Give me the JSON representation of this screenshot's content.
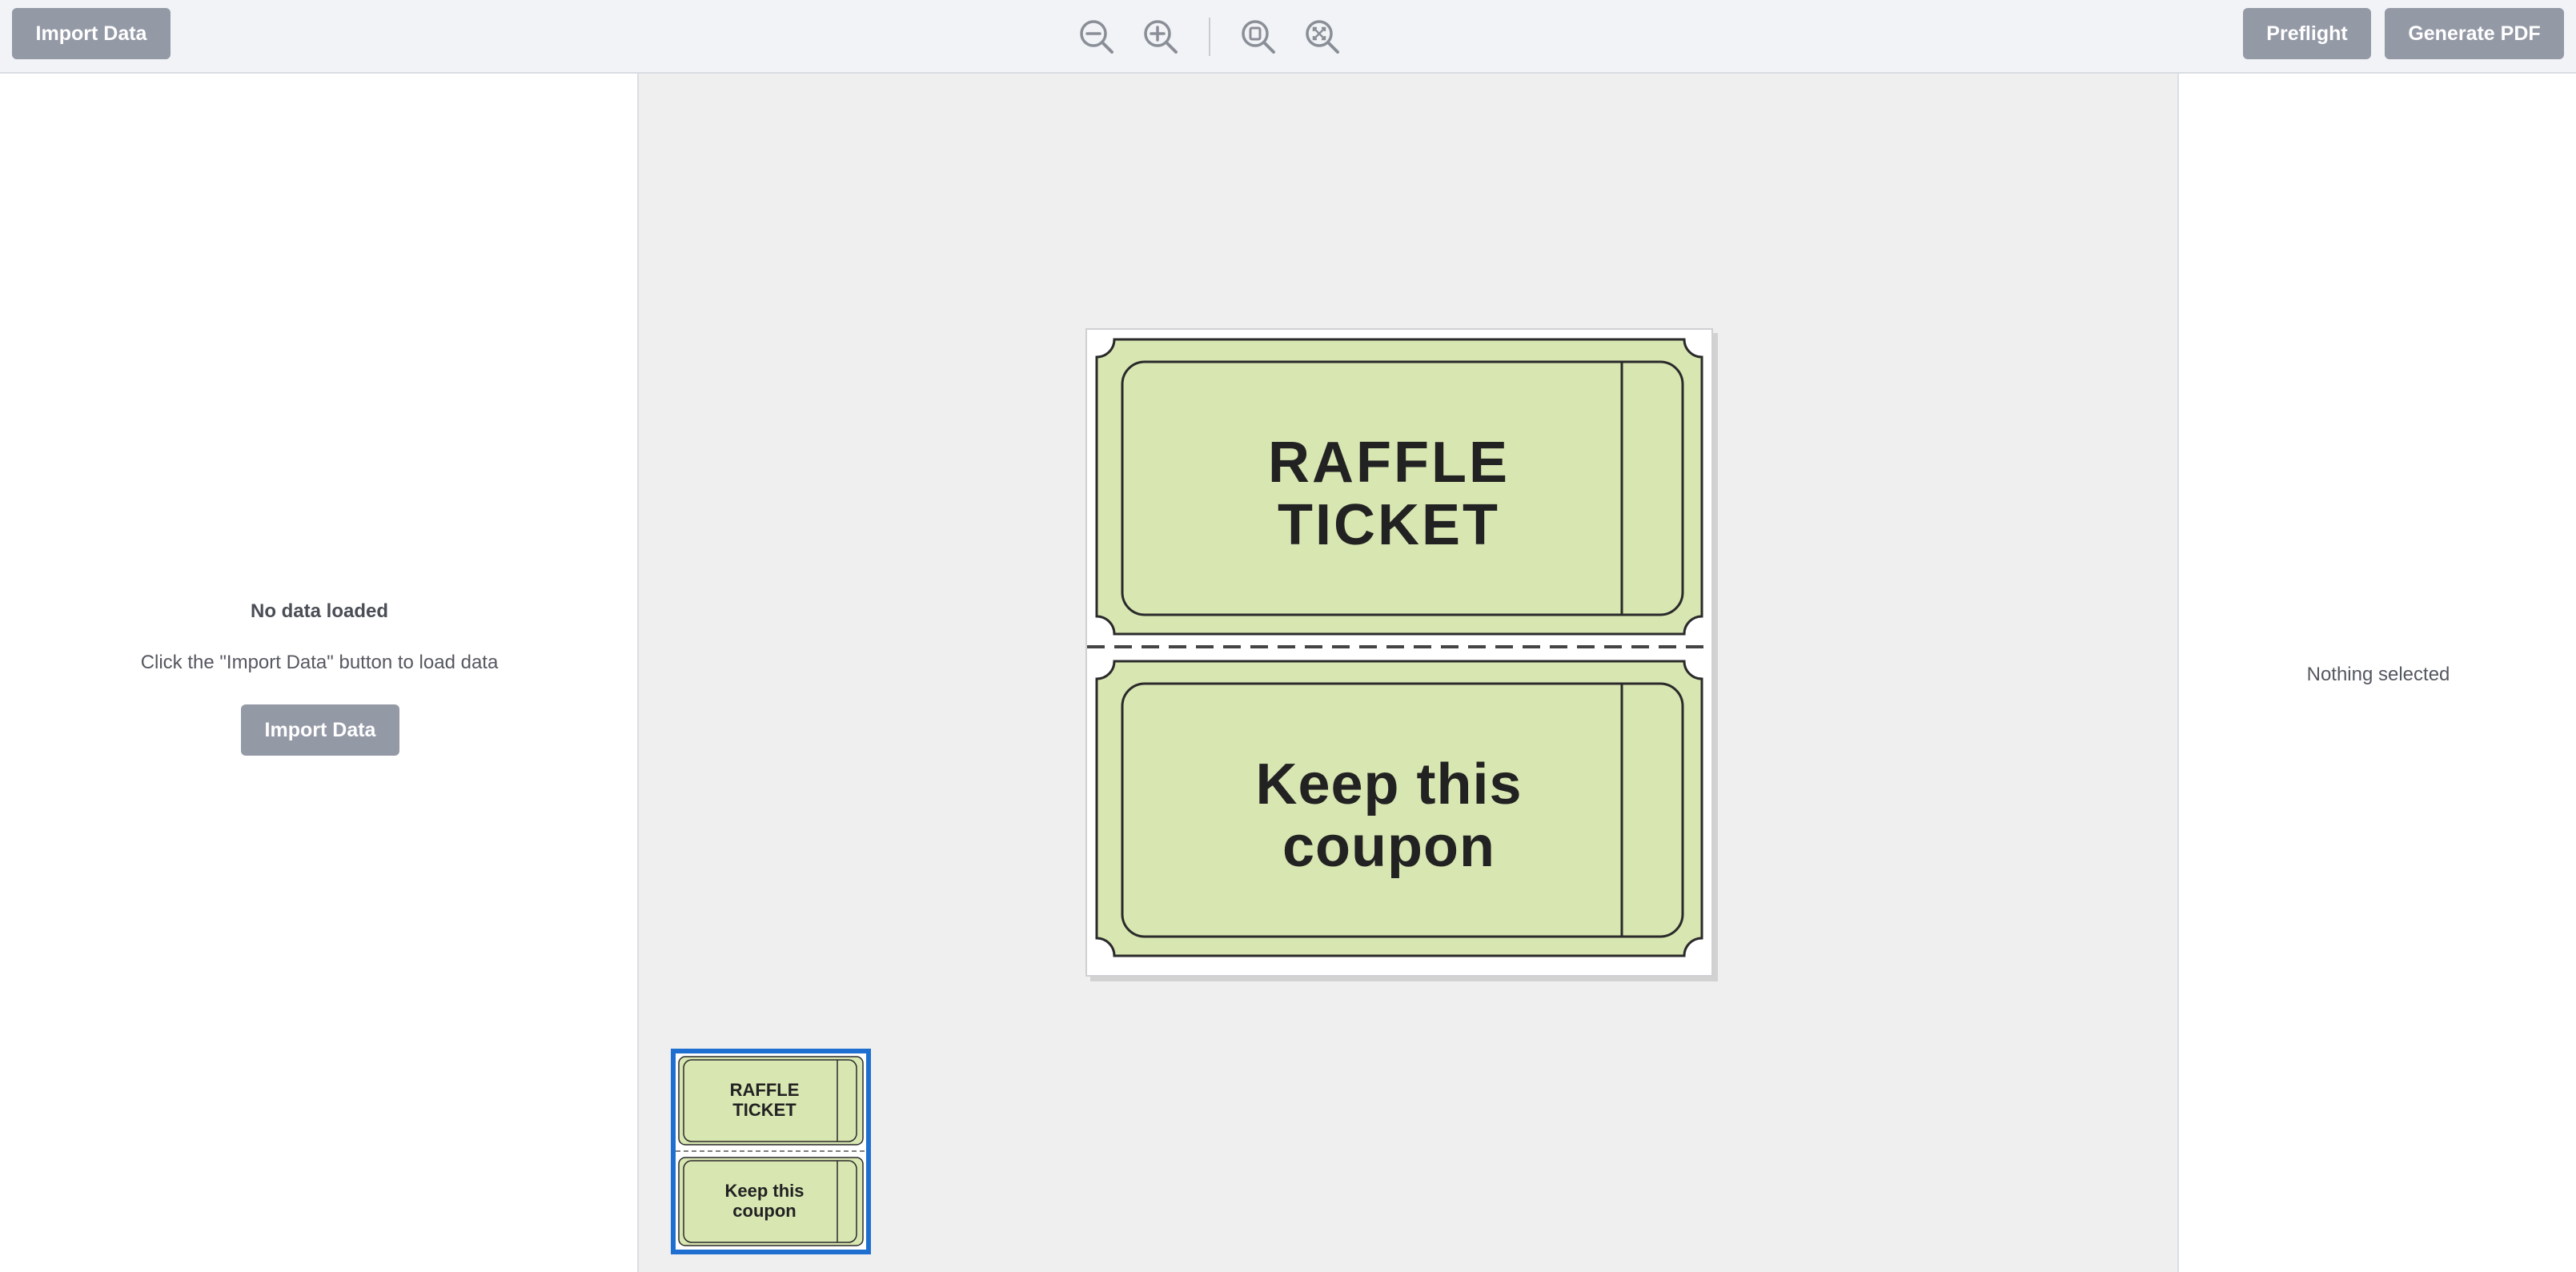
{
  "toolbar": {
    "import_label": "Import Data",
    "preflight_label": "Preflight",
    "generate_label": "Generate PDF",
    "zoom_icons": [
      "zoom-out-icon",
      "zoom-in-icon",
      "zoom-fit-page-icon",
      "zoom-fit-width-icon"
    ]
  },
  "left_panel": {
    "empty_title": "No data loaded",
    "empty_message": "Click the \"Import Data\" button to load data",
    "import_label": "Import Data"
  },
  "right_panel": {
    "empty_message": "Nothing selected"
  },
  "page": {
    "ticket_top_text": "RAFFLE\nTICKET",
    "ticket_bottom_text": "Keep this\ncoupon"
  },
  "thumbnail": {
    "ticket_top_text": "RAFFLE\nTICKET",
    "ticket_bottom_text": "Keep this\ncoupon"
  },
  "colors": {
    "button": "#9499a6",
    "ticket_fill": "#d8e6b2",
    "ticket_stroke": "#2a2a2a",
    "selection": "#1f6fd1",
    "canvas_bg": "#efeff0"
  }
}
